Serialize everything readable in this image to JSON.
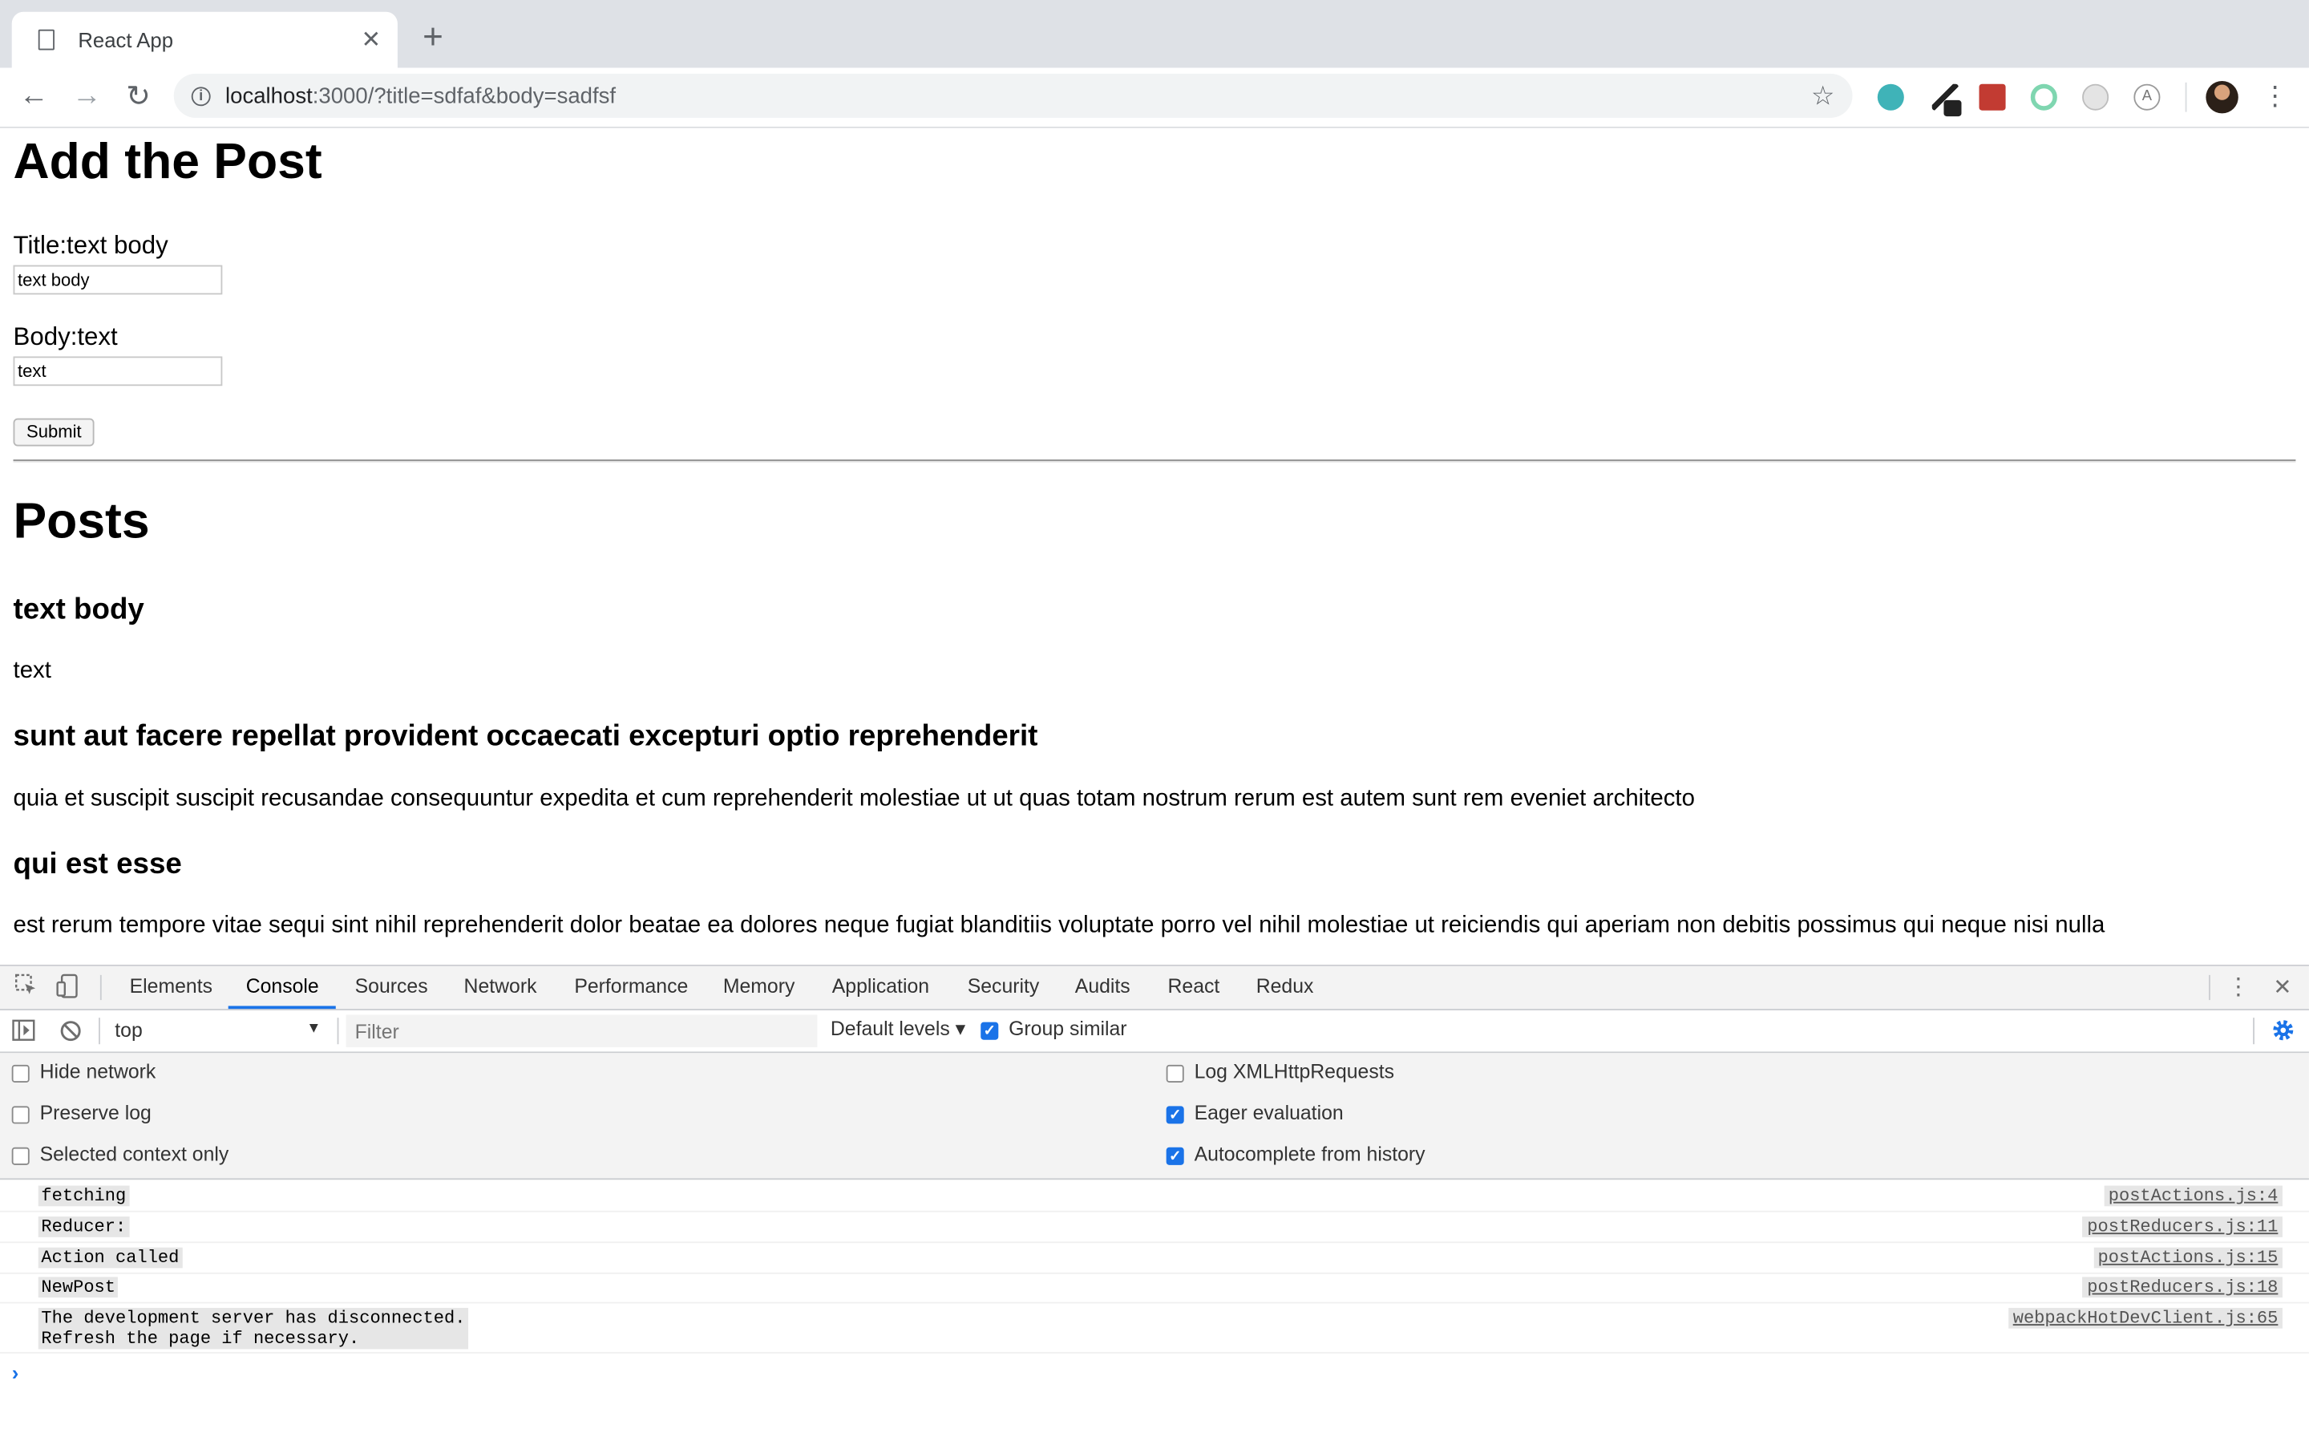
{
  "browser": {
    "tab_title": "React App",
    "tab_close": "✕",
    "new_tab": "+",
    "url_host": "localhost",
    "url_rest": ":3000/?title=sdfaf&body=sadfsf",
    "back": "←",
    "forward": "→",
    "reload": "↻",
    "bookmark_star": "☆",
    "menu": "⋮"
  },
  "form": {
    "heading": "Add the Post",
    "title_label": "Title:text body",
    "title_value": "text body",
    "body_label": "Body:text",
    "body_value": "text",
    "submit_label": "Submit"
  },
  "posts": {
    "heading": "Posts",
    "items": [
      {
        "title": "text body",
        "body": "text"
      },
      {
        "title": "sunt aut facere repellat provident occaecati excepturi optio reprehenderit",
        "body": "quia et suscipit suscipit recusandae consequuntur expedita et cum reprehenderit molestiae ut ut quas totam nostrum rerum est autem sunt rem eveniet architecto"
      },
      {
        "title": "qui est esse",
        "body": "est rerum tempore vitae sequi sint nihil reprehenderit dolor beatae ea dolores neque fugiat blanditiis voluptate porro vel nihil molestiae ut reiciendis qui aperiam non debitis possimus qui neque nisi nulla"
      }
    ]
  },
  "devtools": {
    "tabs": [
      "Elements",
      "Console",
      "Sources",
      "Network",
      "Performance",
      "Memory",
      "Application",
      "Security",
      "Audits",
      "React",
      "Redux"
    ],
    "active_tab": "Console",
    "context": "top",
    "filter_placeholder": "Filter",
    "levels": "Default levels ▾",
    "group_similar": "Group similar",
    "close": "✕",
    "kebab": "⋮",
    "settings_left": [
      {
        "label": "Hide network",
        "checked": false
      },
      {
        "label": "Preserve log",
        "checked": false
      },
      {
        "label": "Selected context only",
        "checked": false
      }
    ],
    "settings_right": [
      {
        "label": "Log XMLHttpRequests",
        "checked": false
      },
      {
        "label": "Eager evaluation",
        "checked": true
      },
      {
        "label": "Autocomplete from history",
        "checked": true
      }
    ],
    "logs": [
      {
        "msg": "fetching",
        "src": "postActions.js:4"
      },
      {
        "msg": "Reducer:",
        "src": "postReducers.js:11"
      },
      {
        "msg": "Action called",
        "src": "postActions.js:15"
      },
      {
        "msg": "NewPost",
        "src": "postReducers.js:18"
      },
      {
        "msg": "The development server has disconnected.\nRefresh the page if necessary.",
        "src": "webpackHotDevClient.js:65"
      }
    ],
    "prompt": "›"
  },
  "colors": {
    "accent": "#1a73e8",
    "tabstrip": "#dee1e6",
    "devtools_bg": "#f3f3f3"
  }
}
